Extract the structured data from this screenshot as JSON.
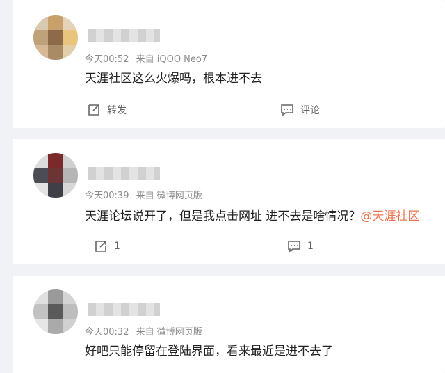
{
  "comments": [
    {
      "time": "今天00:52",
      "source": "来自 iQOO Neo7",
      "text": "天涯社区这么火爆吗，根本进不去",
      "mention": "",
      "share_label": "转发",
      "comment_label": "评论",
      "avatar_colors": [
        "#d9c9b0",
        "#c8a06a",
        "#e5d2b8",
        "#bfa27a",
        "#8d6b4a",
        "#e9c47d",
        "#d7b795",
        "#a98b66",
        "#e0cfa8"
      ]
    },
    {
      "time": "今天00:39",
      "source": "来自 微博网页版",
      "text": "天涯论坛说开了，但是我点击网址 进不去是啥情况？",
      "mention": "@天涯社区",
      "share_label": "1",
      "comment_label": "1",
      "avatar_colors": [
        "#dcdcdc",
        "#7a2a2a",
        "#cfcfcf",
        "#4c4c55",
        "#6b3535",
        "#b5b5b5",
        "#e3e3e3",
        "#3f3f48",
        "#d8d8d8"
      ]
    },
    {
      "time": "今天00:32",
      "source": "来自 微博网页版",
      "text": "好吧只能停留在登陆界面，看来最近是进不去了",
      "mention": "",
      "avatar_colors": [
        "#e0e0e0",
        "#9a9a9a",
        "#d4d4d4",
        "#c2c2c2",
        "#5a5a5a",
        "#bdbdbd",
        "#e6e6e6",
        "#aaaaaa",
        "#d0d0d0"
      ]
    }
  ]
}
